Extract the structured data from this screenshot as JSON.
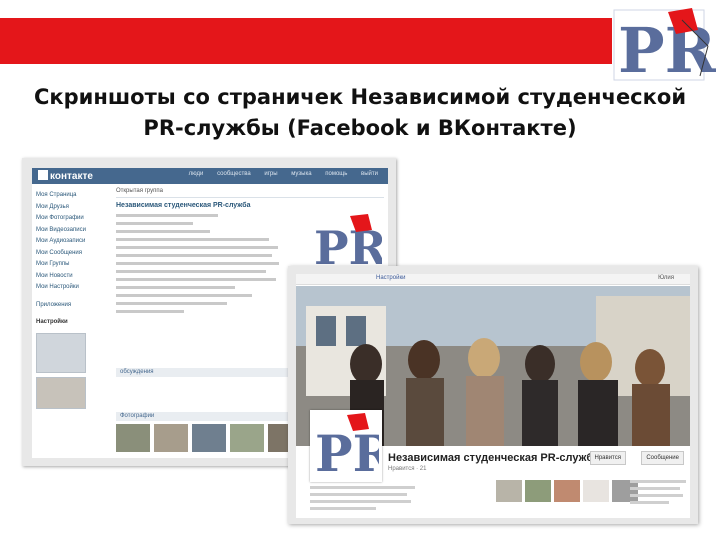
{
  "slide": {
    "title_line1": "Скриншоты со страничек Независимой студенческой",
    "title_line2": "PR-службы (Facebook и ВКонтакте)",
    "logo_letters": "PR",
    "accent_color": "#e4161a",
    "logo_blue": "#5a6d9c"
  },
  "vk": {
    "brand": "контакте",
    "nav": [
      "люди",
      "сообщества",
      "игры",
      "музыка",
      "помощь",
      "выйти"
    ],
    "side_menu": [
      "Моя Страница",
      "Мои Друзья",
      "Мои Фотографии",
      "Мои Видеозаписи",
      "Мои Аудиозаписи",
      "Мои Сообщения",
      "Мои Группы",
      "Мои Новости",
      "Мои Настройки"
    ],
    "side_extra": "Приложения",
    "side_bold": "Настройки",
    "header_text": "Открытая группа",
    "group_name": "Независимая студенческая PR-служба",
    "section_discussions": "обсуждения",
    "section_photos": "Фотографии"
  },
  "fb": {
    "top_label": "Настройки",
    "user_label": "Юлия",
    "page_name": "Независимая студенческая PR-служба",
    "page_sub": "Нравится · 21",
    "like_button": "Нравится",
    "message_button": "Сообщение"
  }
}
